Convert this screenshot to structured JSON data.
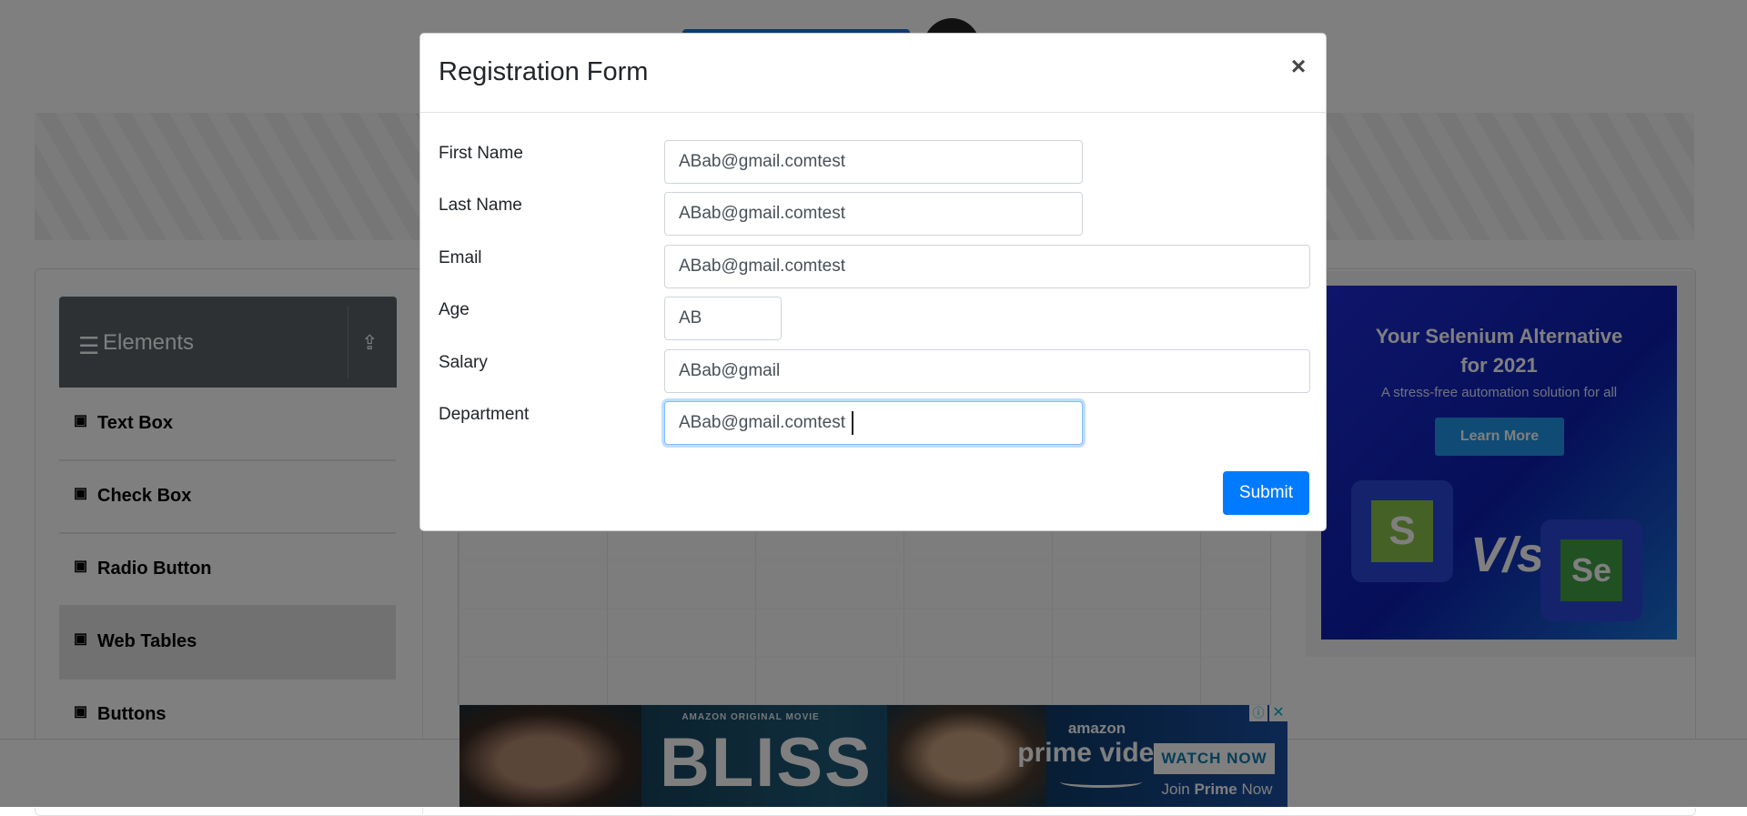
{
  "sidebar": {
    "header": {
      "title": "Elements",
      "hamburger_icon": "menu-icon",
      "collapse_icon": "upload-icon"
    },
    "items": [
      {
        "label": "Text Box",
        "icon": "html5-icon"
      },
      {
        "label": "Check Box",
        "icon": "html5-icon"
      },
      {
        "label": "Radio Button",
        "icon": "html5-icon"
      },
      {
        "label": "Web Tables",
        "icon": "html5-icon",
        "active": true
      },
      {
        "label": "Buttons",
        "icon": "html5-icon"
      }
    ]
  },
  "right_ad": {
    "title_line1": "Your Selenium Alternative",
    "title_line2": "for 2021",
    "subtitle": "A stress-free automation solution for all",
    "button": "Learn More",
    "vs": "V/s",
    "left_logo": "S",
    "right_logo": "Se"
  },
  "bottom_ad": {
    "kicker": "AMAZON ORIGINAL MOVIE",
    "movie": "BLISS",
    "brand_small": "amazon",
    "brand": "prime video",
    "cta": "WATCH NOW",
    "join_prefix": "Join ",
    "join_bold": "Prime",
    "join_suffix": " Now",
    "adchoices_icon": "ⓘ",
    "close_icon": "✕"
  },
  "modal": {
    "title": "Registration Form",
    "close": "×",
    "fields": {
      "first_name": {
        "label": "First Name",
        "value": "ABab@gmail.comtest"
      },
      "last_name": {
        "label": "Last Name",
        "value": "ABab@gmail.comtest"
      },
      "email": {
        "label": "Email",
        "value": "ABab@gmail.comtest"
      },
      "age": {
        "label": "Age",
        "value": "AB"
      },
      "salary": {
        "label": "Salary",
        "value": "ABab@gmail"
      },
      "department": {
        "label": "Department",
        "value": "ABab@gmail.comtest"
      }
    },
    "submit": "Submit"
  },
  "colors": {
    "primary": "#007bff",
    "sidebar_header": "#5a6269",
    "backdrop": "rgba(0,0,0,0.5)"
  }
}
